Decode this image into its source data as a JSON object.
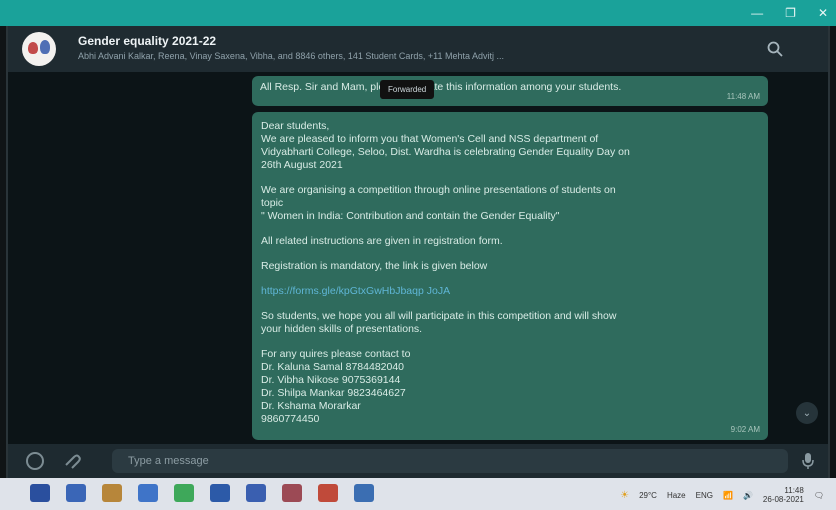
{
  "chat": {
    "title": "Gender equality 2021-22",
    "participants": "Abhi Advani Kalkar, Reena, Vinay Saxena, Vibha, and 8846 others, 141 Student Cards, +11 Mehta Advitj ..."
  },
  "messages": {
    "first": {
      "text": "All Resp. Sir and Mam, please circulate this information among your students.",
      "tag": "Forwarded",
      "time": "11:48 AM"
    },
    "second": {
      "lines": [
        "Dear students,",
        "We are pleased to inform you that Women's Cell and NSS department of",
        "Vidyabharti College, Seloo, Dist. Wardha is celebrating Gender Equality Day on",
        "26th August 2021",
        "",
        "We are organising a competition through online presentations of students on",
        "topic",
        "\" Women in India: Contribution and contain the Gender Equality\"",
        "",
        "All related instructions are given in registration form.",
        "",
        "Registration is mandatory, the link is given below",
        "",
        "https://forms.gle/kpGtxGwHbJbaqp JoJA",
        "",
        "So students, we hope you all will participate in this competition and will show",
        "your hidden skills of presentations.",
        "",
        "For any quires please contact to",
        "Dr. Kaluna Samal 8784482040",
        "Dr. Vibha Nikose 9075369144",
        "Dr. Shilpa Mankar 9823464627",
        "Dr. Kshama Morarkar",
        "9860774450"
      ],
      "link_index": 13,
      "time": "9:02 AM"
    }
  },
  "composer": {
    "placeholder": "Type a message"
  },
  "window_controls": {
    "minimize": "—",
    "maximize": "❐",
    "close": "✕"
  },
  "taskbar": {
    "icons": [
      "start-icon",
      "search-icon",
      "file-explorer-icon",
      "mail-icon",
      "whatsapp-icon",
      "word-icon",
      "dropbox-icon",
      "photos-icon",
      "media-icon",
      "settings-icon"
    ],
    "icon_colors": [
      "#2a4f9e",
      "#3a66b7",
      "#b7863a",
      "#3f74c8",
      "#3ea85a",
      "#2c5aa8",
      "#3a5fb0",
      "#9c4a55",
      "#c04a3a",
      "#3b6eb2"
    ],
    "temp": "29°C",
    "weather": "Haze",
    "language": "ENG",
    "time": "11:48",
    "date": "26-08-2021"
  }
}
